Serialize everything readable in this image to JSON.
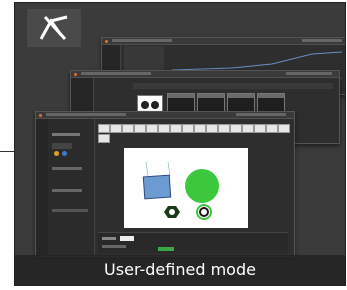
{
  "caption": "User-defined mode",
  "logo": {
    "icon": "px-logo-icon"
  },
  "colors": {
    "card_bg": "#3b3b3b",
    "accent_green": "#3cc83c",
    "shape_blue": "#6c9bd1"
  },
  "windows": [
    {
      "name": "back-window"
    },
    {
      "name": "middle-window"
    },
    {
      "name": "front-window"
    }
  ]
}
